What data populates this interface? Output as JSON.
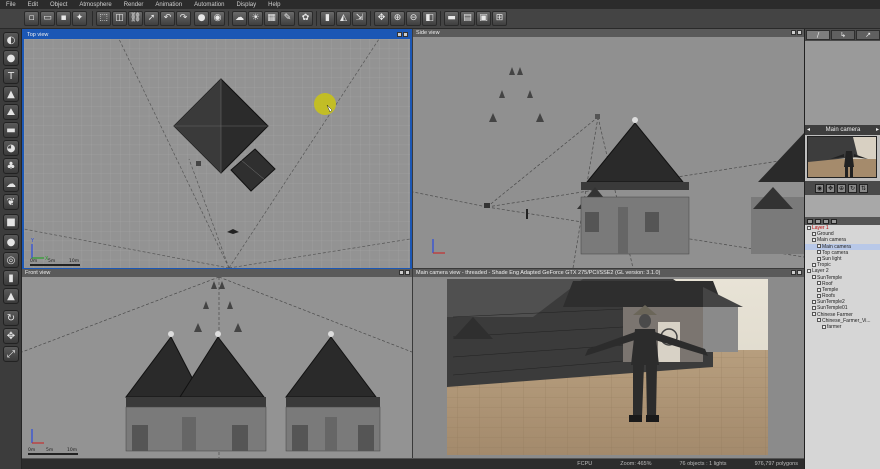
{
  "menu": [
    "File",
    "Edit",
    "Object",
    "Atmosphere",
    "Render",
    "Animation",
    "Automation",
    "Display",
    "Help"
  ],
  "toolbar_icons": [
    "new-icon",
    "open-icon",
    "save-icon",
    "import-icon",
    "select-icon",
    "undo-icon",
    "redo-icon",
    "render-icon",
    "render-area-icon",
    "render-options-icon",
    "light-icon",
    "material-icon",
    "plant-icon",
    "object-icon",
    "terrain-icon",
    "zoom-icon",
    "pan-icon",
    "zoom-in-icon",
    "zoom-out-icon",
    "fit-icon",
    "layout-1-icon",
    "layout-2-icon",
    "layout-3-icon",
    "layout-4-icon"
  ],
  "left_tools": [
    "globe-icon",
    "sphere-icon",
    "text-icon",
    "terrain-icon",
    "mountain-icon",
    "water-icon",
    "rock-icon",
    "plant-icon",
    "cloud-icon",
    "leaf-icon",
    "cube-icon",
    "sphere-small-icon",
    "torus-icon",
    "cylinder-icon",
    "cone-icon",
    "pyramid-icon",
    "move-icon",
    "rotate-icon",
    "scale-icon"
  ],
  "viewports": {
    "top": {
      "title": "Top view",
      "scale": [
        "0m",
        "5m",
        "10m"
      ]
    },
    "side": {
      "title": "Side view"
    },
    "front": {
      "title": "Front view",
      "scale": [
        "0m",
        "5m",
        "10m"
      ]
    },
    "main": {
      "title": "Main camera view - threaded - Shade Eng Adapted GeForce GTX 275/PCI/SSE2 (GL version: 3.1.0)"
    }
  },
  "right_panel": {
    "tabs": [
      "/",
      "↳",
      "↗"
    ],
    "camera_label": "Main camera",
    "tree": [
      {
        "label": "Layer 1",
        "indent": 0,
        "red": true
      },
      {
        "label": "Ground",
        "indent": 1
      },
      {
        "label": "Main camera",
        "indent": 1
      },
      {
        "label": "Main camera",
        "indent": 2,
        "selected": true
      },
      {
        "label": "Top camera",
        "indent": 2
      },
      {
        "label": "Sun light",
        "indent": 2
      },
      {
        "label": "Tropic",
        "indent": 1
      },
      {
        "label": "Layer 2",
        "indent": 0
      },
      {
        "label": "SunTemple",
        "indent": 1
      },
      {
        "label": "Roof",
        "indent": 2
      },
      {
        "label": "Temple",
        "indent": 2
      },
      {
        "label": "Roofs",
        "indent": 2
      },
      {
        "label": "SunTemple2",
        "indent": 1
      },
      {
        "label": "SunTemple01",
        "indent": 1
      },
      {
        "label": "Chinese Farmer",
        "indent": 1
      },
      {
        "label": "Chinese_Farmer_Vi...",
        "indent": 2
      },
      {
        "label": "farmer",
        "indent": 3
      }
    ]
  },
  "status": {
    "fps": "FCPU",
    "zoom": "Zoom: 465%",
    "objects": "76 objects : 1 lights",
    "polygons": "976,797 polygons"
  },
  "colors": {
    "accent": "#1b57b5",
    "viewport_bg": "#8f8f8f",
    "ui_dark": "#3a3a3a"
  }
}
